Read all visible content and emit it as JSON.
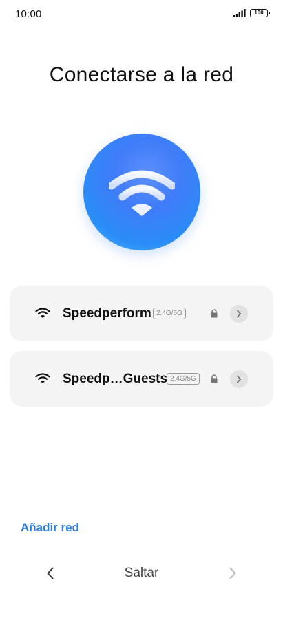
{
  "status_bar": {
    "time": "10:00",
    "battery": "100",
    "icons": [
      "signal-icon",
      "battery-icon"
    ]
  },
  "page": {
    "title": "Conectarse a la red",
    "hero_icon": "wifi-icon",
    "accent_color": "#2f7fdf"
  },
  "networks": [
    {
      "name": "Speedperform",
      "band": "2.4G/5G",
      "secured": true,
      "icons": [
        "wifi-icon",
        "lock-icon",
        "chevron-right-icon"
      ]
    },
    {
      "name": "Speedp…Guests",
      "band": "2.4G/5G",
      "secured": true,
      "icons": [
        "wifi-icon",
        "lock-icon",
        "chevron-right-icon"
      ]
    }
  ],
  "actions": {
    "add_network": "Añadir red",
    "skip": "Saltar",
    "back_icon": "chevron-left-icon",
    "next_icon": "chevron-right-icon"
  }
}
